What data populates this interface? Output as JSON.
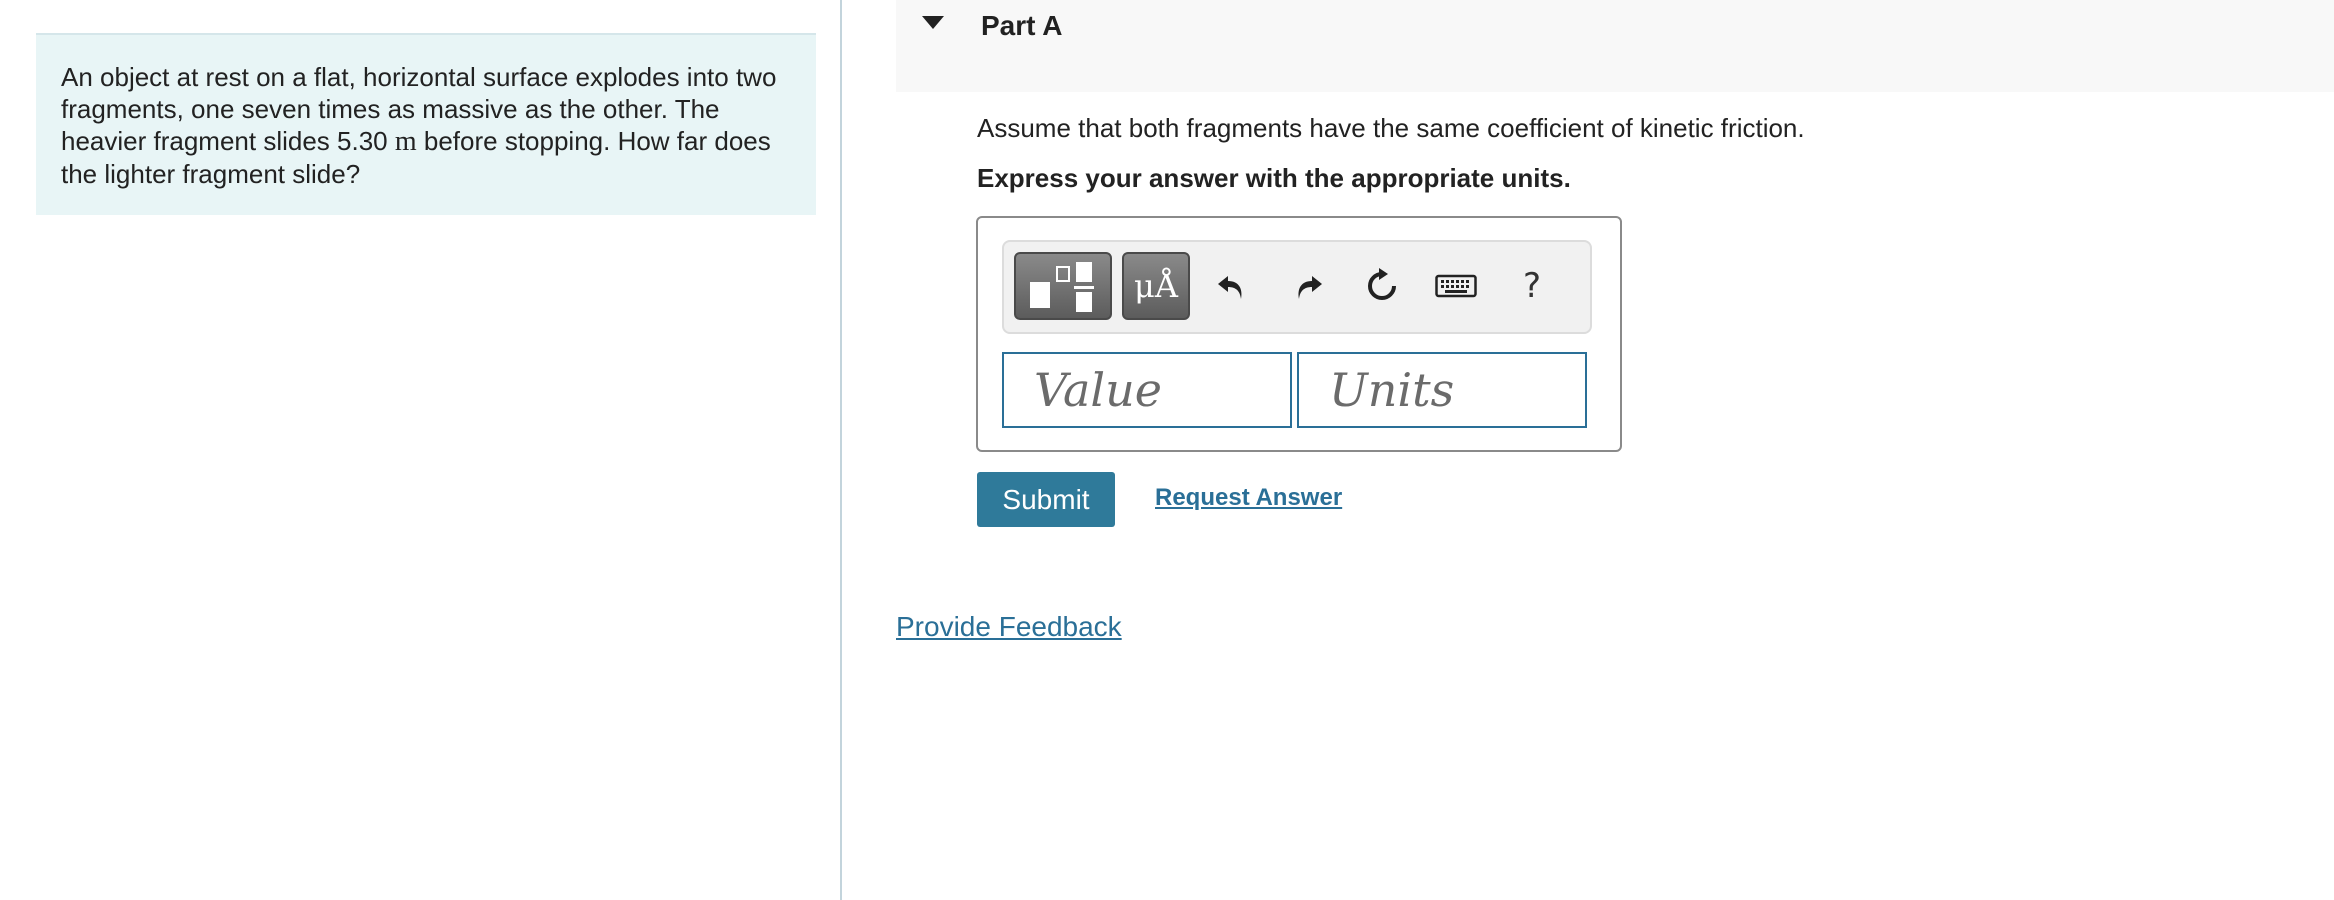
{
  "problem": {
    "text_before": "An object at rest on a flat, horizontal surface explodes into two fragments, one seven times as massive as the other. The heavier fragment slides ",
    "distance_value": "5.30",
    "distance_unit": "m",
    "text_after": " before stopping. How far does the lighter fragment slide?"
  },
  "part": {
    "title": "Part A",
    "instruction": "Assume that both fragments have the same coefficient of kinetic friction.",
    "instruction_bold": "Express your answer with the appropriate units."
  },
  "toolbar": {
    "units_label": "μÅ",
    "help_label": "?"
  },
  "inputs": {
    "value_placeholder": "Value",
    "units_placeholder": "Units"
  },
  "actions": {
    "submit_label": "Submit",
    "request_answer_label": "Request Answer",
    "feedback_label": "Provide Feedback"
  },
  "colors": {
    "accent": "#2f7a9a",
    "link": "#2a6f97",
    "problem_bg": "#e8f5f6"
  }
}
